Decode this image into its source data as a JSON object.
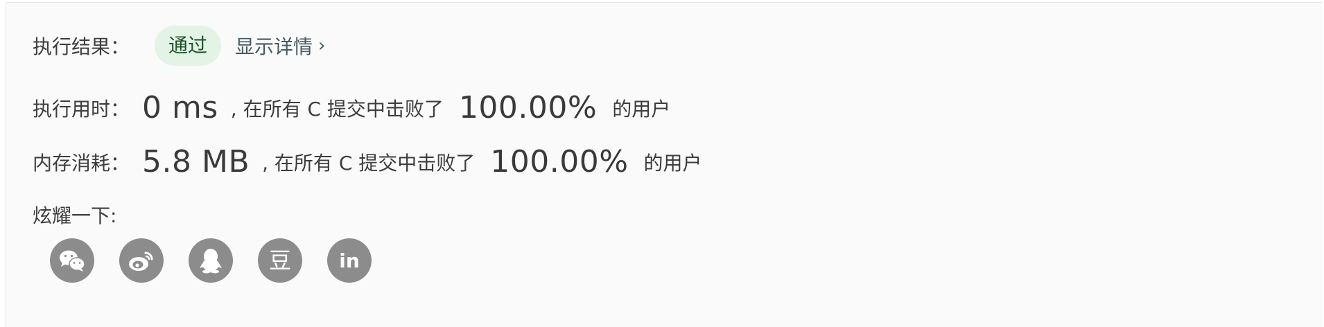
{
  "result": {
    "label": "执行结果：",
    "status": "通过",
    "details_link": "显示详情",
    "details_chevron": "›"
  },
  "runtime": {
    "label": "执行用时：",
    "value": "0 ms",
    "mid_text": ", 在所有 C 提交中击败了",
    "percent": "100.00%",
    "suffix": "的用户"
  },
  "memory": {
    "label": "内存消耗：",
    "value": "5.8 MB",
    "mid_text": ", 在所有 C 提交中击败了",
    "percent": "100.00%",
    "suffix": "的用户"
  },
  "share": {
    "label": "炫耀一下:",
    "icons": [
      "wechat-icon",
      "weibo-icon",
      "qq-icon",
      "douban-icon",
      "linkedin-icon"
    ],
    "douban_glyph": "豆",
    "linkedin_glyph": "in"
  },
  "colors": {
    "badge_bg": "#e3f4e6",
    "badge_text": "#1f5128",
    "link": "#455a64",
    "icon_bg": "#8c8c8c",
    "panel_bg": "#fafafa"
  }
}
